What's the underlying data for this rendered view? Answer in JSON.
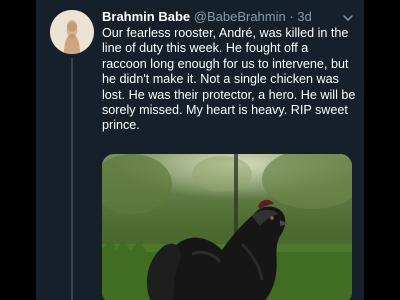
{
  "tweet": {
    "display_name": "Brahmin Babe",
    "handle": "@BabeBrahmin",
    "separator": "·",
    "time": "3d",
    "text": "Our fearless rooster, André, was killed in the line of duty this week. He fought off a raccoon long enough for us to intervene, but he didn't make it. Not a single chicken was lost. He was their protector, a hero. He will be sorely missed. My heart is heavy. RIP sweet prince.",
    "menu_icon": "chevron-down-icon",
    "media": {
      "kind": "photo",
      "subject": "rooster"
    }
  },
  "colors": {
    "background": "#000000",
    "card": "#15202b",
    "text": "#ffffff",
    "secondary_text": "#8899a6",
    "thread_line": "#38444d"
  }
}
